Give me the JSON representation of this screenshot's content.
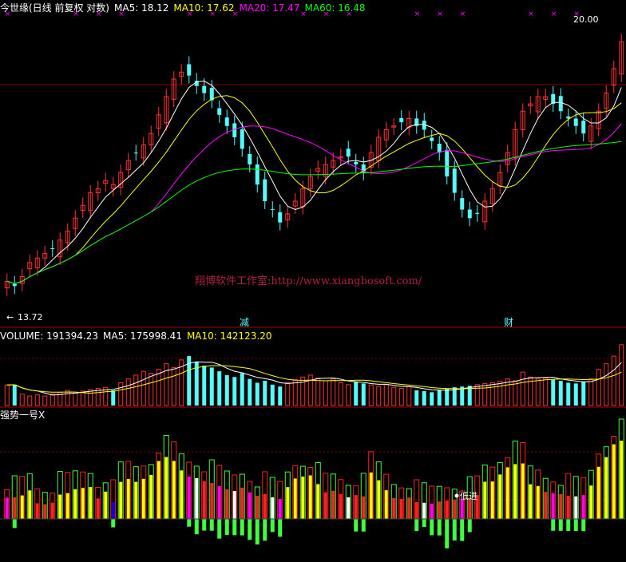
{
  "price_header": {
    "title": "今世缘(日线 前复权 对数)",
    "ma5": "MA5: 18.12",
    "ma10": "MA10: 17.62",
    "ma20": "MA20: 17.47",
    "ma60": "MA60: 16.48"
  },
  "volume_header": {
    "title": "VOLUME: 191394.23",
    "ma5": "MA5: 175998.41",
    "ma10": "MA10: 142123.20"
  },
  "indicator_header": {
    "title": "强势一号X"
  },
  "price_labels": {
    "high": "20.00",
    "low": "13.72",
    "marker_jian": "减",
    "marker_cai": "财",
    "watermark": "翔博软件工作室:http://www.xiangbosoft.com/",
    "signal_low": "低进"
  },
  "colors": {
    "background": "#000000",
    "up": "#ff3232",
    "down": "#54fcfc",
    "ma5": "#ffffff",
    "ma10": "#ffff00",
    "ma20": "#ff00ff",
    "ma60": "#00ff00",
    "grid": "#800000",
    "watermark": "#9f1f3f",
    "ind_red": "#ff2020",
    "ind_yellow": "#ffff00",
    "ind_magenta": "#ff00ff",
    "ind_blue": "#0000ff",
    "ind_white": "#ffffff",
    "ind_green": "#40ff40"
  },
  "chart_data": [
    {
      "type": "candlestick",
      "title": "今世缘(日线 前复权 对数)",
      "ylim": [
        13.2,
        20.8
      ],
      "log_scale": true,
      "grid": true,
      "high_label": 20.0,
      "low_label": 13.72,
      "close_series": [
        13.9,
        13.8,
        14.0,
        14.3,
        14.4,
        14.5,
        14.6,
        14.8,
        15.0,
        15.3,
        15.6,
        15.9,
        16.0,
        16.2,
        16.1,
        16.4,
        16.7,
        16.9,
        17.1,
        17.4,
        17.9,
        18.4,
        18.9,
        19.1,
        19.0,
        18.7,
        18.5,
        18.3,
        17.9,
        17.6,
        17.3,
        17.0,
        16.6,
        16.1,
        15.7,
        15.5,
        15.2,
        15.4,
        15.7,
        16.0,
        16.3,
        16.5,
        16.6,
        16.7,
        16.8,
        16.8,
        16.6,
        16.4,
        16.9,
        17.3,
        17.5,
        17.6,
        17.7,
        17.8,
        17.6,
        17.5,
        17.2,
        16.9,
        16.3,
        15.9,
        15.5,
        15.3,
        15.4,
        15.7,
        16.0,
        16.4,
        16.9,
        17.5,
        18.0,
        18.2,
        18.4,
        18.4,
        18.2,
        18.0,
        17.8,
        17.6,
        17.4,
        17.6,
        18.0,
        18.5,
        19.2,
        20.0
      ],
      "series": [
        {
          "name": "MA5",
          "value": 18.12
        },
        {
          "name": "MA10",
          "value": 17.62
        },
        {
          "name": "MA20",
          "value": 17.47
        },
        {
          "name": "MA60",
          "value": 16.48
        }
      ]
    },
    {
      "type": "bar",
      "title": "VOLUME: 191394.23",
      "volume_series": [
        54,
        55,
        30,
        25,
        28,
        25,
        30,
        35,
        40,
        33,
        38,
        42,
        45,
        48,
        40,
        60,
        70,
        80,
        90,
        85,
        95,
        110,
        100,
        120,
        130,
        115,
        105,
        100,
        90,
        80,
        75,
        85,
        70,
        60,
        65,
        55,
        50,
        60,
        68,
        75,
        80,
        72,
        65,
        70,
        60,
        55,
        62,
        58,
        54,
        50,
        55,
        48,
        45,
        50,
        40,
        38,
        35,
        42,
        45,
        48,
        50,
        52,
        55,
        58,
        60,
        64,
        70,
        65,
        88,
        75,
        70,
        72,
        68,
        65,
        60,
        58,
        62,
        70,
        95,
        110,
        130,
        160
      ],
      "series": [
        {
          "name": "MA5",
          "value": 175998.41
        },
        {
          "name": "MA10",
          "value": 142123.2
        }
      ]
    },
    {
      "type": "bar",
      "title": "强势一号X"
    }
  ]
}
